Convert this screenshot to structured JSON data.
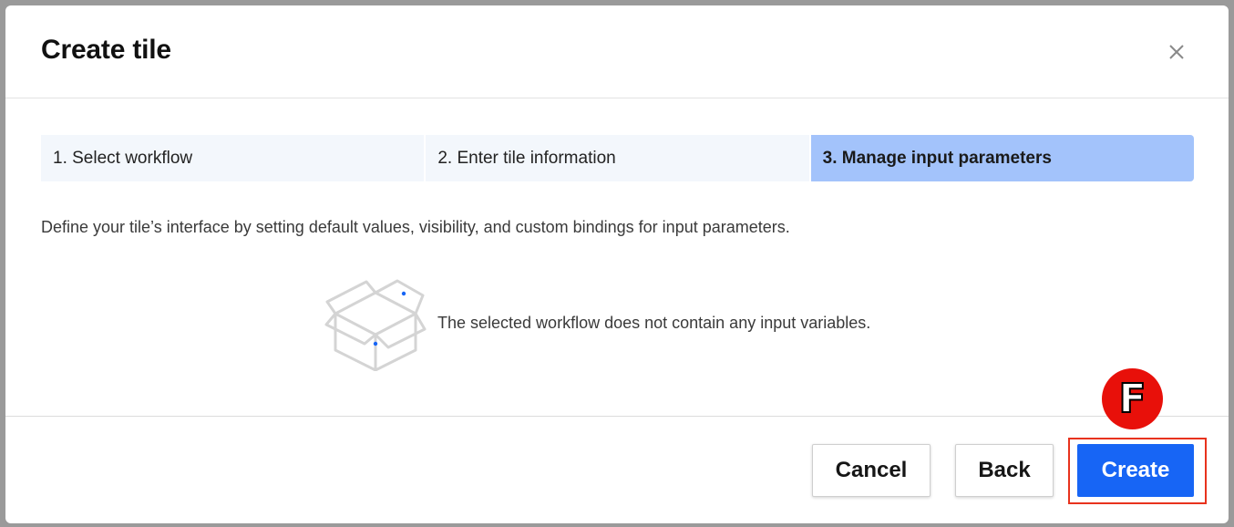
{
  "dialog": {
    "title": "Create tile",
    "close_icon": "close-icon"
  },
  "steps": [
    {
      "label": "1. Select workflow",
      "active": false
    },
    {
      "label": "2. Enter tile information",
      "active": false
    },
    {
      "label": "3. Manage input parameters",
      "active": true
    }
  ],
  "main": {
    "description": "Define your tile’s interface by setting default values, visibility, and custom bindings for input parameters.",
    "empty_state": {
      "icon": "open-box-icon",
      "message": "The selected workflow does not contain any input variables."
    }
  },
  "footer": {
    "cancel_label": "Cancel",
    "back_label": "Back",
    "create_label": "Create"
  },
  "annotation": {
    "marker_label": "F"
  },
  "colors": {
    "primary": "#1765f5",
    "active_step": "#a3c3fb",
    "inactive_step": "#f3f7fc",
    "highlight": "#e8321d",
    "marker": "#e8100a"
  }
}
